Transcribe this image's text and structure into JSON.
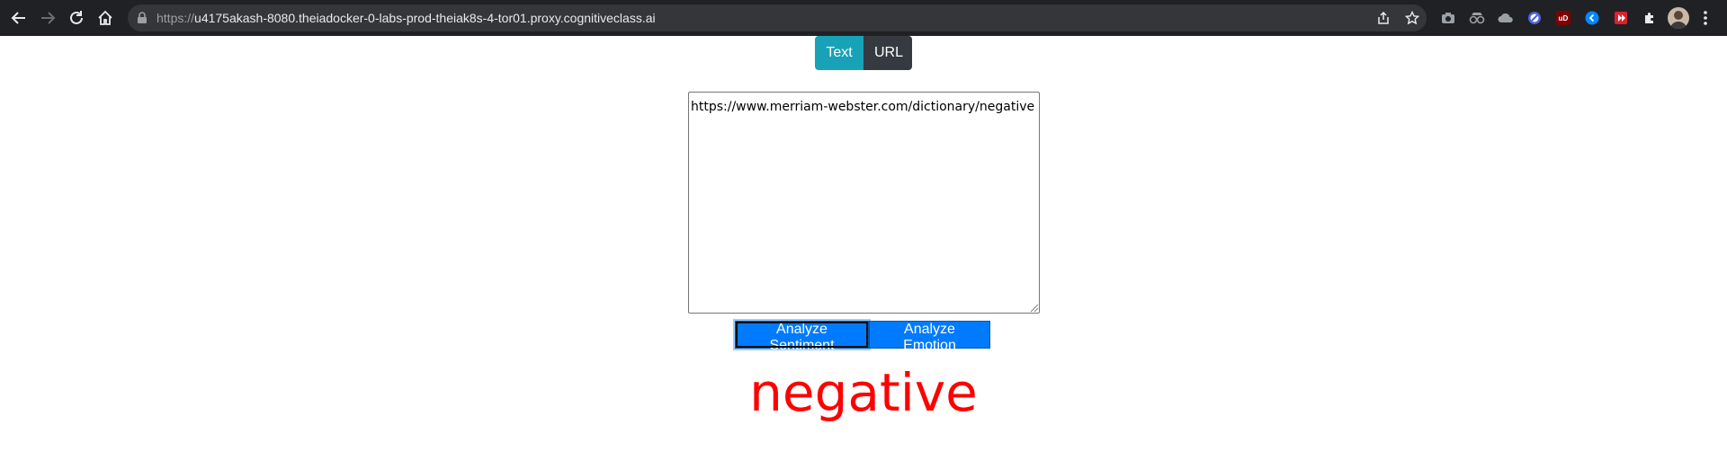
{
  "browser": {
    "url_scheme": "https://",
    "url_host": "u4175akash-8080.theiadocker-0-labs-prod-theiak8s-4-tor01.proxy.cognitiveclass.ai",
    "extensions": [
      {
        "name": "camera-icon",
        "color": "#9aa0a6"
      },
      {
        "name": "spy-icon",
        "color": "#9aa0a6"
      },
      {
        "name": "cloud-icon",
        "color": "#9aa0a6"
      },
      {
        "name": "block-icon",
        "color": "#4a63d8"
      },
      {
        "name": "ublock-icon",
        "color": "#800000",
        "label": "uD"
      },
      {
        "name": "shazam-icon",
        "color": "#0088ff"
      },
      {
        "name": "video-icon",
        "color": "#e0202a"
      },
      {
        "name": "puzzle-icon",
        "color": "#e8eaed"
      }
    ]
  },
  "mode_toggle": {
    "text_label": "Text",
    "url_label": "URL"
  },
  "input": {
    "value": "https://www.merriam-webster.com/dictionary/negative"
  },
  "actions": {
    "sentiment_label": "Analyze Sentiment",
    "emotion_label": "Analyze Emotion"
  },
  "result": {
    "text": "negative",
    "color": "#ff0000"
  }
}
